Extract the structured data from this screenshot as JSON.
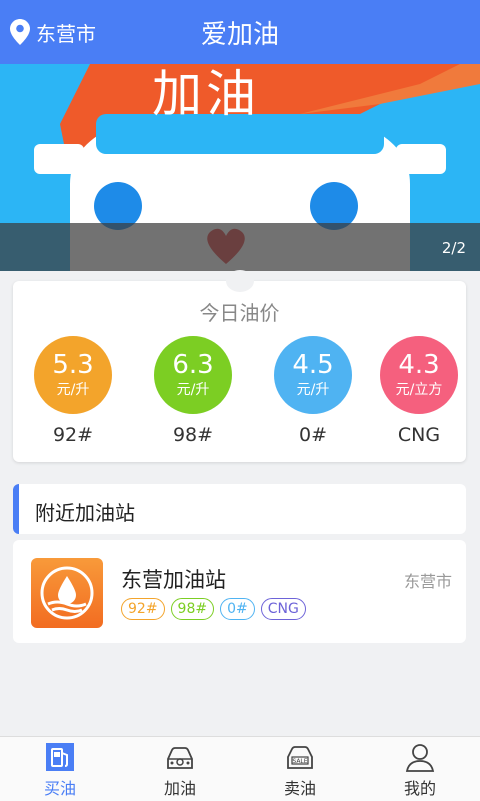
{
  "header": {
    "city": "东营市",
    "title": "爱加油",
    "color": "#4a7ef5"
  },
  "banner": {
    "slide_text": "加油",
    "counter": "2/2"
  },
  "prices": {
    "title": "今日油价",
    "items": [
      {
        "value": "5.3",
        "unit": "元/升",
        "name": "92#",
        "color": "#f3a42b"
      },
      {
        "value": "6.3",
        "unit": "元/升",
        "name": "98#",
        "color": "#7cce23"
      },
      {
        "value": "4.5",
        "unit": "元/升",
        "name": "0#",
        "color": "#4fb3f2"
      },
      {
        "value": "4.3",
        "unit": "元/立方",
        "name": "CNG",
        "color": "#f5607e"
      }
    ]
  },
  "nearby": {
    "title": "附近加油站",
    "stations": [
      {
        "name": "东营加油站",
        "city": "东营市",
        "tags": [
          "92#",
          "98#",
          "0#",
          "CNG"
        ]
      }
    ]
  },
  "tabbar": {
    "items": [
      {
        "label": "买油",
        "icon": "fuel-pump-icon",
        "active": true
      },
      {
        "label": "加油",
        "icon": "car-icon"
      },
      {
        "label": "卖油",
        "icon": "sale-car-icon"
      },
      {
        "label": "我的",
        "icon": "user-icon"
      }
    ]
  }
}
